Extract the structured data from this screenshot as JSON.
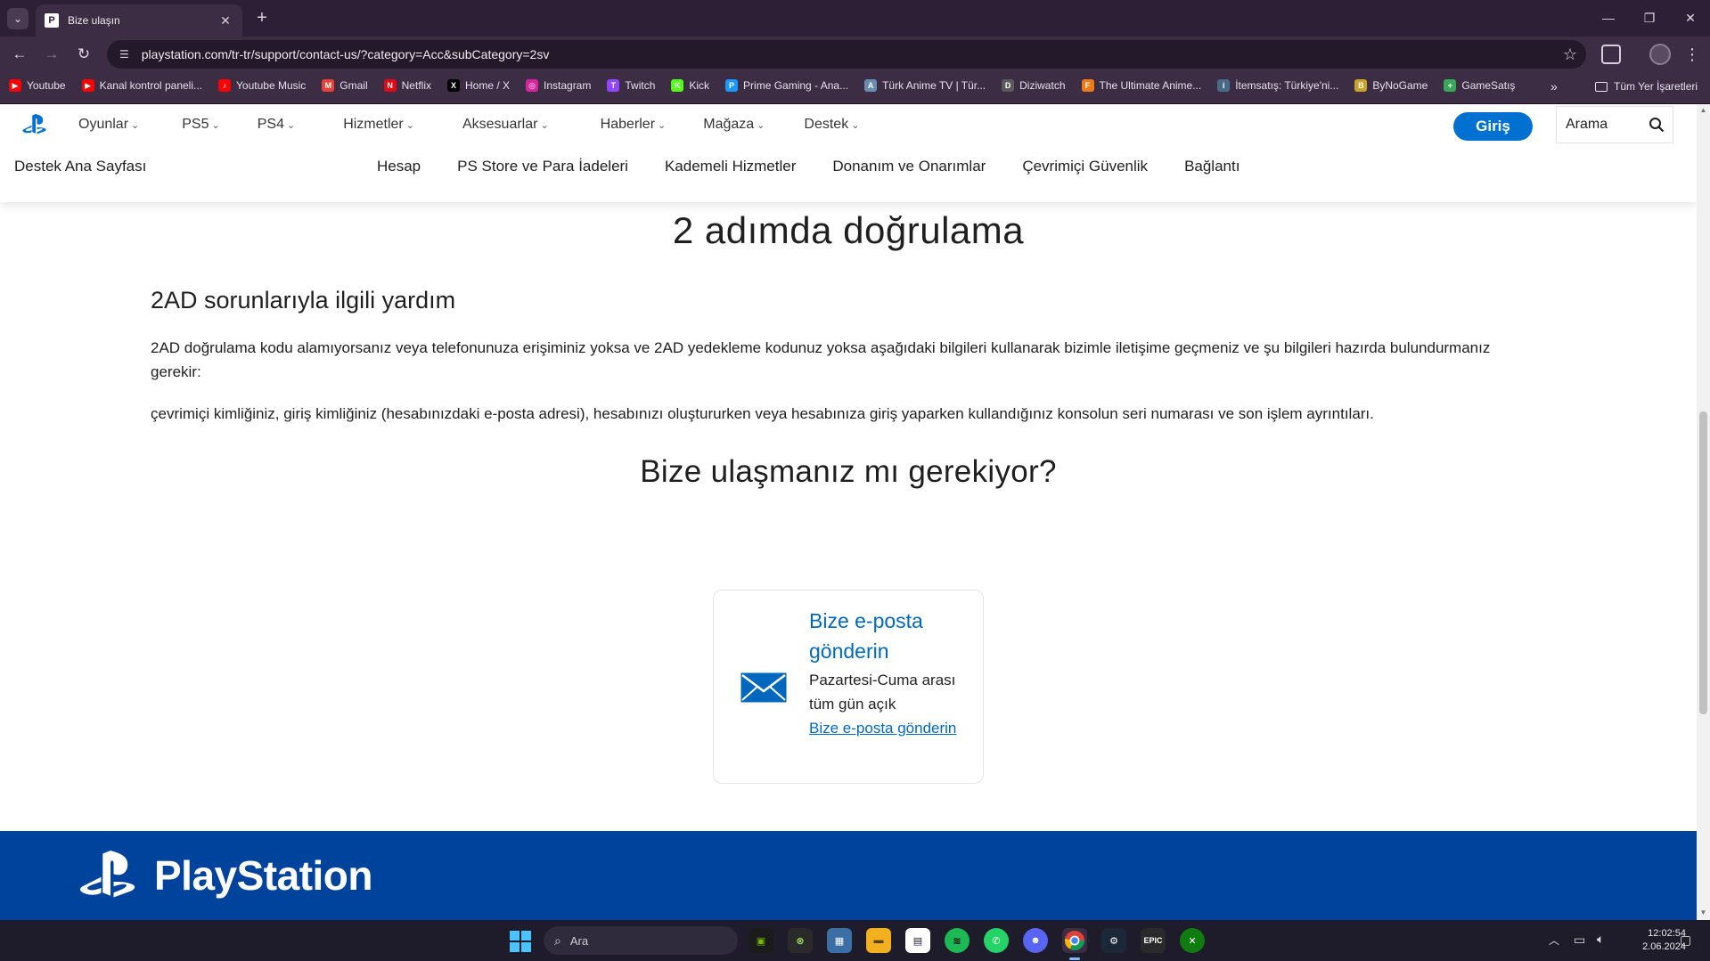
{
  "browser": {
    "tab_title": "Bize ulaşın",
    "url": "playstation.com/tr-tr/support/contact-us/?category=Acc&subCategory=2sv",
    "bookmarks": [
      {
        "label": "Youtube",
        "color": "#ff0000",
        "glyph": "▶"
      },
      {
        "label": "Kanal kontrol paneli...",
        "color": "#ff0000",
        "glyph": "▶"
      },
      {
        "label": "Youtube Music",
        "color": "#ff0000",
        "glyph": "♪"
      },
      {
        "label": "Gmail",
        "color": "#ea4335",
        "glyph": "M"
      },
      {
        "label": "Netflix",
        "color": "#e50914",
        "glyph": "N"
      },
      {
        "label": "Home / X",
        "color": "#000000",
        "glyph": "X"
      },
      {
        "label": "Instagram",
        "color": "#d6249f",
        "glyph": "◎"
      },
      {
        "label": "Twitch",
        "color": "#9146ff",
        "glyph": "T"
      },
      {
        "label": "Kick",
        "color": "#53fc18",
        "glyph": "K"
      },
      {
        "label": "Prime Gaming - Ana...",
        "color": "#1a98ff",
        "glyph": "P"
      },
      {
        "label": "Türk Anime TV | Tür...",
        "color": "#6a8caf",
        "glyph": "A"
      },
      {
        "label": "Diziwatch",
        "color": "#5a5a5a",
        "glyph": "D"
      },
      {
        "label": "The Ultimate Anime...",
        "color": "#f07b16",
        "glyph": "F"
      },
      {
        "label": "İtemsatış: Türkiye'ni...",
        "color": "#4a6a8a",
        "glyph": "i"
      },
      {
        "label": "ByNoGame",
        "color": "#c9a227",
        "glyph": "B"
      },
      {
        "label": "GameSatış",
        "color": "#3aa657",
        "glyph": "+"
      }
    ],
    "all_bookmarks": "Tüm Yer İşaretleri"
  },
  "nav": {
    "menu": [
      {
        "label": "Oyunlar"
      },
      {
        "label": "PS5"
      },
      {
        "label": "PS4"
      },
      {
        "label": "Hizmetler"
      },
      {
        "label": "Aksesuarlar"
      },
      {
        "label": "Haberler"
      },
      {
        "label": "Mağaza"
      },
      {
        "label": "Destek"
      }
    ],
    "signin": "Giriş",
    "search_placeholder": "Arama"
  },
  "subnav": {
    "home": "Destek Ana Sayfası",
    "links": [
      {
        "label": "Hesap"
      },
      {
        "label": "PS Store ve Para İadeleri"
      },
      {
        "label": "Kademeli Hizmetler"
      },
      {
        "label": "Donanım ve Onarımlar"
      },
      {
        "label": "Çevrimiçi Güvenlik"
      },
      {
        "label": "Bağlantı"
      }
    ]
  },
  "content": {
    "heading": "2 adımda doğrulama",
    "section_title": "2AD sorunlarıyla ilgili yardım",
    "para1": "2AD doğrulama kodu alamıyorsanız veya telefonunuza erişiminiz yoksa ve 2AD yedekleme kodunuz yoksa aşağıdaki bilgileri kullanarak bizimle iletişime geçmeniz ve şu bilgileri hazırda bulundurmanız gerekir:",
    "para2": "çevrimiçi kimliğiniz, giriş kimliğiniz (hesabınızdaki e-posta adresi), hesabınızı oluştururken veya hesabınıza giriş yaparken kullandığınız konsolun seri numarası ve son işlem ayrıntıları.",
    "contact_heading": "Bize ulaşmanız mı gerekiyor?",
    "card": {
      "title": "Bize e-posta gönderin",
      "hours": "Pazartesi-Cuma arası tüm gün açık",
      "link": "Bize e-posta gönderin"
    }
  },
  "footer": {
    "brand": "PlayStation"
  },
  "taskbar": {
    "search_placeholder": "Ara",
    "time": "12:02:54",
    "date": "2.06.2024"
  },
  "colors": {
    "accent": "#0070d1",
    "link": "#0068bd",
    "footer": "#00439c"
  }
}
